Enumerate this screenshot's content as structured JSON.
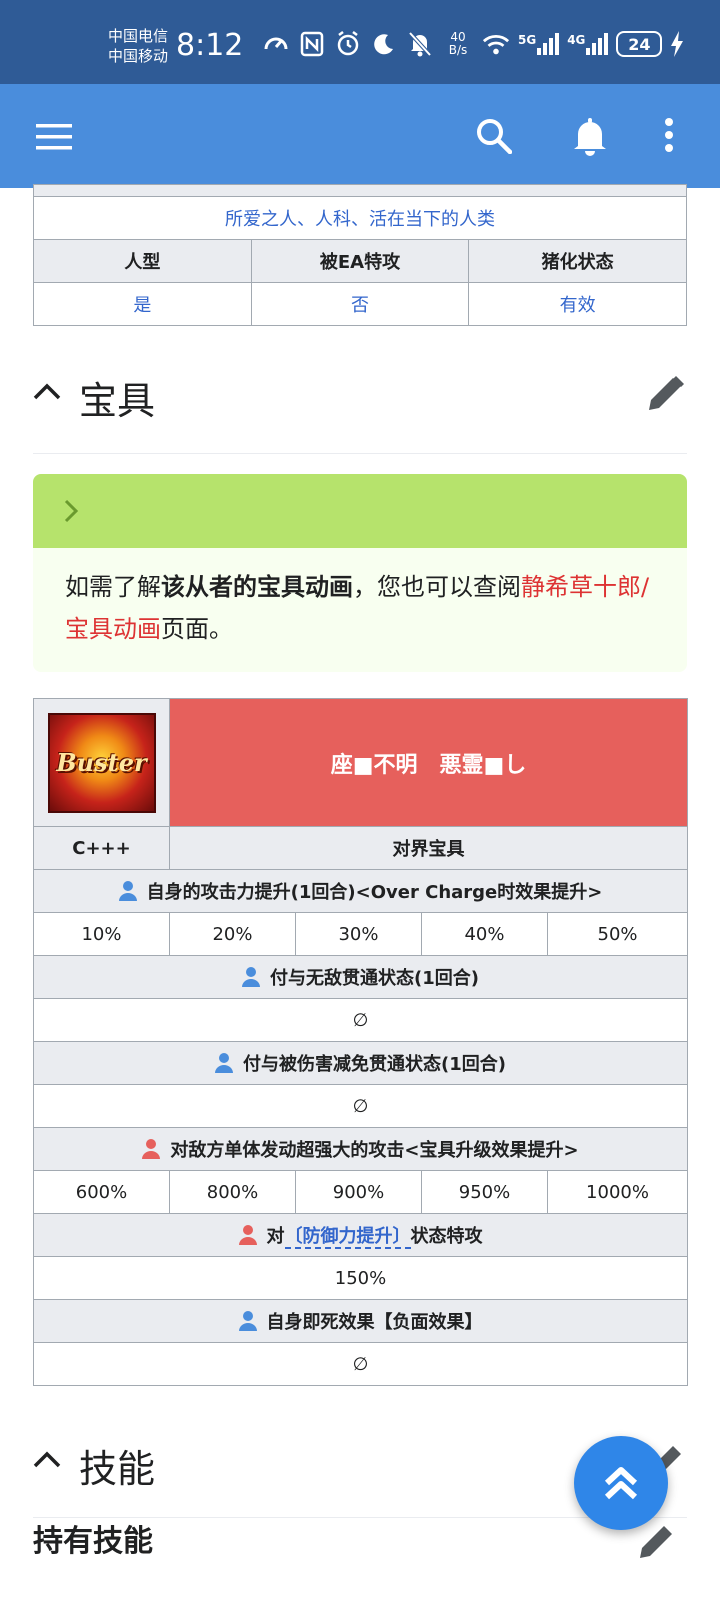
{
  "status_bar": {
    "carrier_1": "中国电信",
    "carrier_2": "中国移动",
    "time": "8:12",
    "net_speed_value": "40",
    "net_speed_unit": "B/s",
    "signal_1": "5G",
    "signal_2": "4G",
    "battery": "24"
  },
  "toolbar": {
    "icons": [
      "menu-icon",
      "search-icon",
      "bell-icon",
      "more-vert-icon"
    ]
  },
  "traits_table": {
    "traits_value": "所爱之人、人科、活在当下的人类",
    "headers": [
      "人型",
      "被EA特攻",
      "猪化状态"
    ],
    "values": [
      "是",
      "否",
      "有效"
    ]
  },
  "section_np": {
    "title": "宝具"
  },
  "notice": {
    "text_1": "如需了解",
    "bold": "该从者的宝具动画",
    "text_2": "，您也可以查阅",
    "link": "静希草十郎/宝具动画",
    "text_3": "页面。"
  },
  "np_table": {
    "card_type": "Buster",
    "name": "座■不明　悪霊■し",
    "rank": "C+++",
    "type": "对界宝具",
    "effects": [
      {
        "title": "自身的攻击力提升(1回合)<Over Charge时效果提升>",
        "icon_color": "#4a8ddc",
        "values": [
          "10%",
          "20%",
          "30%",
          "40%",
          "50%"
        ]
      },
      {
        "title": "付与无敌贯通状态(1回合)",
        "icon_color": "#4a8ddc",
        "value": "∅"
      },
      {
        "title": "付与被伤害减免贯通状态(1回合)",
        "icon_color": "#4a8ddc",
        "value": "∅"
      },
      {
        "title": "对敌方单体发动超强大的攻击<宝具升级效果提升>",
        "icon_color": "#e6605c",
        "values": [
          "600%",
          "800%",
          "900%",
          "950%",
          "1000%"
        ]
      },
      {
        "title_pre": "对",
        "title_link": "〔防御力提升〕",
        "title_post": "状态特攻",
        "icon_color": "#e6605c",
        "value": "150%"
      },
      {
        "title": "自身即死效果【负面效果】",
        "icon_color": "#4a8ddc",
        "value": "∅"
      }
    ]
  },
  "section_skills": {
    "title": "技能",
    "subheading": "持有技能"
  },
  "fab": {
    "icon": "double-chevron-up-icon"
  }
}
